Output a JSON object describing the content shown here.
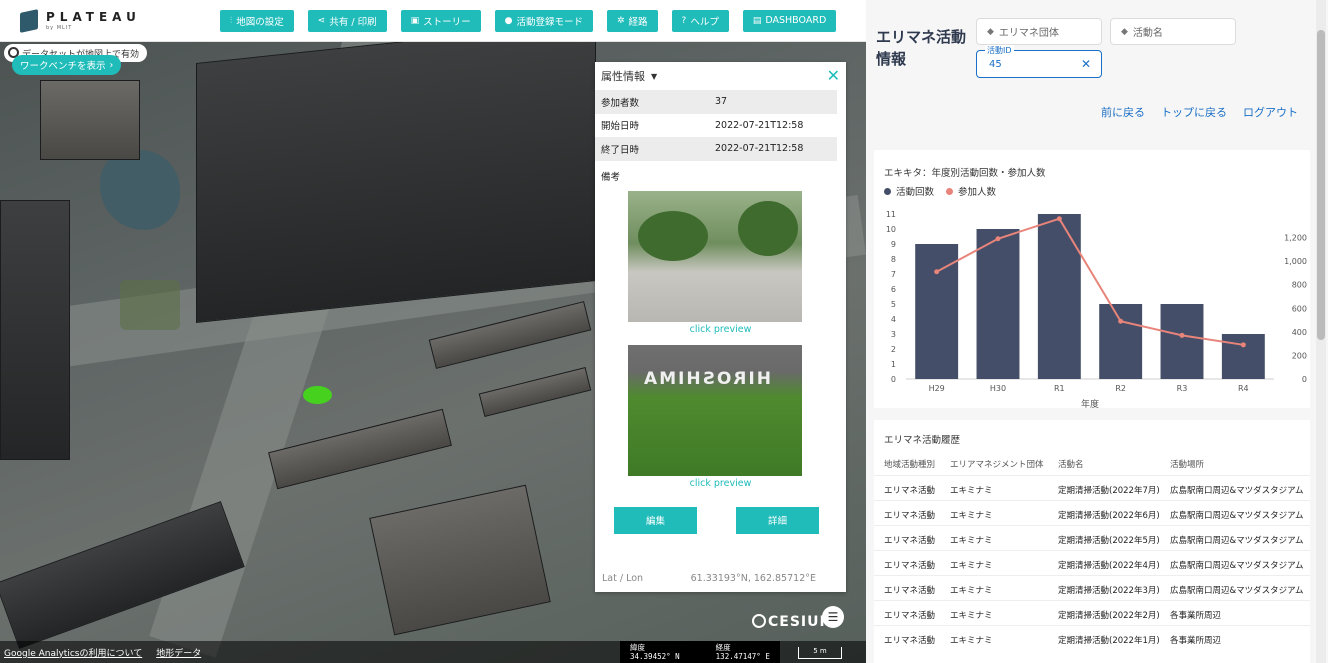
{
  "app": {
    "logo_text": "PLATEAU",
    "logo_sub": "by MLIT"
  },
  "topnav": [
    {
      "icon": "sliders-icon",
      "label": "地図の設定"
    },
    {
      "icon": "share-icon",
      "label": "共有 / 印刷"
    },
    {
      "icon": "story-icon",
      "label": "ストーリー"
    },
    {
      "icon": "users-icon",
      "label": "活動登録モード"
    },
    {
      "icon": "route-icon",
      "label": "経路"
    },
    {
      "icon": "help-icon",
      "label": "ヘルプ"
    },
    {
      "icon": "book-icon",
      "label": "DASHBOARD"
    }
  ],
  "map": {
    "hint": "データセットが地図上で有効",
    "workbench_label": "ワークベンチを表示",
    "analytics_link": "Google Analyticsの利用について",
    "terrain_link": "地形データ",
    "coord_lat_label": "緯度",
    "coord_lat": "34.39452° N",
    "coord_lon_label": "経度",
    "coord_lon": "132.47147° E",
    "scale_label": "5 m",
    "cesium_label": "CESIUM"
  },
  "attr_panel": {
    "title": "属性情報",
    "rows": [
      {
        "label": "参加者数",
        "value": "37"
      },
      {
        "label": "開始日時",
        "value": "2022-07-21T12:58"
      },
      {
        "label": "終了日時",
        "value": "2022-07-21T12:58"
      }
    ],
    "remarks_label": "備考",
    "preview1": "click preview",
    "preview2": "click preview",
    "edit_label": "編集",
    "detail_label": "詳細",
    "latlon_label": "Lat / Lon",
    "latlon_value": "61.33193°N, 162.85712°E"
  },
  "right": {
    "title": "エリマネ活動情報",
    "search_group_placeholder": "エリマネ団体",
    "search_name_placeholder": "活動名",
    "id_label": "活動ID",
    "id_value": "45",
    "nav_back": "前に戻る",
    "nav_top": "トップに戻る",
    "nav_logout": "ログアウト",
    "chart_title": "エキキタ：年度別活動回数・参加人数",
    "legend_count": "活動回数",
    "legend_people": "参加人数",
    "x_axis_label": "年度",
    "history_title": "エリマネ活動履歴",
    "history_headers": [
      "地域活動種別",
      "エリアマネジメント団体",
      "活動名",
      "活動場所"
    ],
    "history_rows": [
      [
        "エリマネ活動",
        "エキミナミ",
        "定期清掃活動(2022年7月)",
        "広島駅南口周辺&マツダスタジアム"
      ],
      [
        "エリマネ活動",
        "エキミナミ",
        "定期清掃活動(2022年6月)",
        "広島駅南口周辺&マツダスタジアム"
      ],
      [
        "エリマネ活動",
        "エキミナミ",
        "定期清掃活動(2022年5月)",
        "広島駅南口周辺&マツダスタジアム"
      ],
      [
        "エリマネ活動",
        "エキミナミ",
        "定期清掃活動(2022年4月)",
        "広島駅南口周辺&マツダスタジアム"
      ],
      [
        "エリマネ活動",
        "エキミナミ",
        "定期清掃活動(2022年3月)",
        "広島駅南口周辺&マツダスタジアム"
      ],
      [
        "エリマネ活動",
        "エキミナミ",
        "定期清掃活動(2022年2月)",
        "各事業所周辺"
      ],
      [
        "エリマネ活動",
        "エキミナミ",
        "定期清掃活動(2022年1月)",
        "各事業所周辺"
      ]
    ]
  },
  "colors": {
    "accent": "#1fbcba",
    "bar": "#444e68",
    "line": "#e8847a",
    "link": "#1a6fc6"
  },
  "chart_data": {
    "type": "bar",
    "title": "エキキタ：年度別活動回数・参加人数",
    "categories": [
      "H29",
      "H30",
      "R1",
      "R2",
      "R3",
      "R4"
    ],
    "series": [
      {
        "name": "活動回数",
        "type": "bar",
        "axis": "left",
        "values": [
          9,
          10,
          11,
          5,
          5,
          3
        ]
      },
      {
        "name": "参加人数",
        "type": "line",
        "axis": "right",
        "values": [
          910,
          1190,
          1360,
          490,
          370,
          290
        ]
      }
    ],
    "xlabel": "年度",
    "ylim_left": [
      0,
      11
    ],
    "ylim_right": [
      0,
      1400
    ],
    "yticks_left": [
      0,
      1,
      2,
      3,
      4,
      5,
      6,
      7,
      8,
      9,
      10,
      11
    ],
    "yticks_right": [
      0,
      200,
      400,
      600,
      800,
      1000,
      1200
    ],
    "yticks_right_labels": [
      "0",
      "200",
      "400",
      "600",
      "800",
      "1,000",
      "1,200"
    ],
    "grid": false,
    "legend_position": "top-left"
  }
}
